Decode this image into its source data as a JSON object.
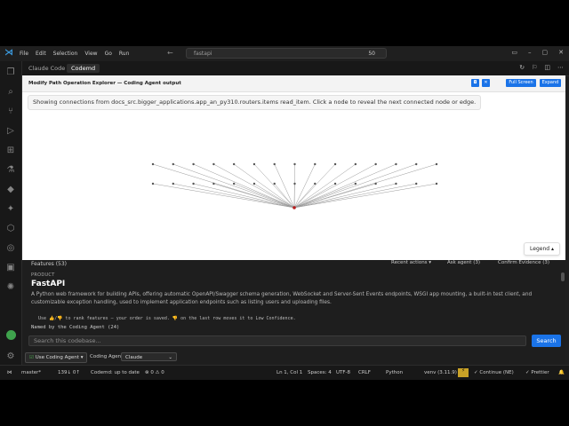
{
  "menu": [
    "File",
    "Edit",
    "Selection",
    "View",
    "Go",
    "Run"
  ],
  "nav_arrows": "← →",
  "command_center": {
    "placeholder": "fastapi",
    "count": "50"
  },
  "tabs": [
    {
      "label": "Claude Code",
      "active": false
    },
    {
      "label": "Codemd",
      "active": true
    }
  ],
  "panel": {
    "title": "Modify Path Operation Explorer — Coding Agent output",
    "full_screen": "Full Screen",
    "expand": "Expand",
    "info": "Showing connections from docs_src.bigger_applications.app_an_py310.routers.items read_item. Click a node to reveal the next connected node or edge.",
    "legend": "Legend"
  },
  "graph": {
    "node_color": "#555555",
    "root_color": "#b71c1c",
    "top_row_count": 15,
    "second_row_count": 15
  },
  "features": {
    "header": "Features (53)",
    "pill_1": "Recent actions ▾",
    "pill_2": "Ask agent (3)",
    "pill_3": "Confirm Evidence (3)",
    "product_label": "PRODUCT",
    "title": "FastAPI",
    "description": "A Python web framework for building APIs, offering automatic OpenAPI/Swagger schema generation, WebSocket and Server-Sent Events endpoints, WSGI app mounting, a built-in test client, and customizable exception handling, used to implement application endpoints such as listing users and uploading files.",
    "rank_note": "Use 👍/👎 to rank features — your order is saved. 👎 on the last row moves it to Low Confidence.",
    "named_by": "Named by the Coding Agent (24)"
  },
  "search": {
    "placeholder": "Search this codebase...",
    "button": "Search"
  },
  "agent": {
    "toggle": "Use Coding Agent ▾",
    "label": "Coding Agent",
    "selected": "Claude"
  },
  "status": {
    "branch": "master*",
    "sync": "139↓ 0↑",
    "codemd": "Codemd: up to date",
    "problems": "⊗ 0 ⚠ 0",
    "position": "Ln 1, Col 1",
    "spaces": "Spaces: 4",
    "encoding": "UTF-8",
    "eol": "CRLF",
    "language": "Python",
    "venv": "venv (3.11.9)",
    "continue": "✓ Continue (NE)",
    "prettier": "✓ Prettier"
  }
}
